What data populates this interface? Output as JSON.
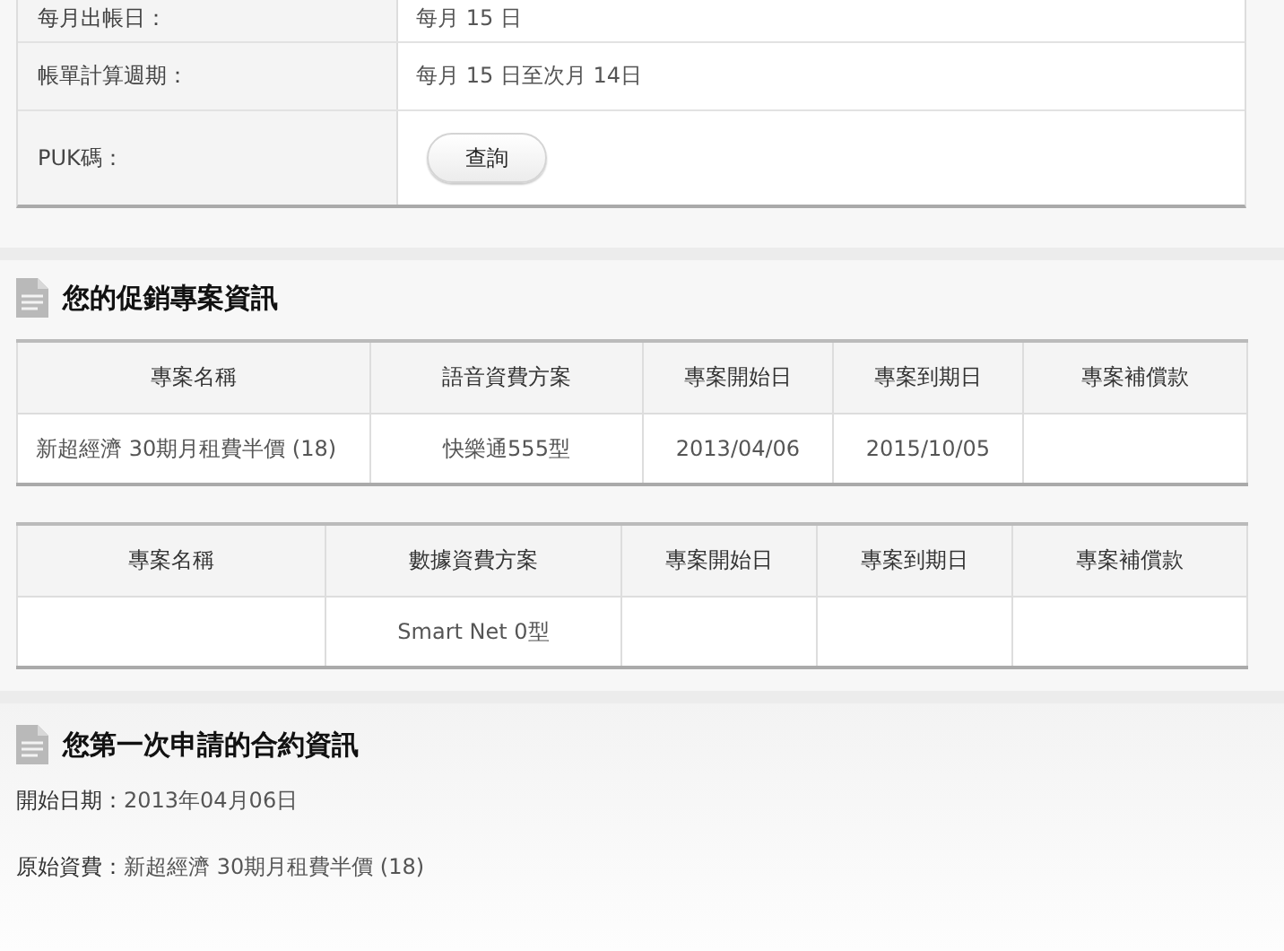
{
  "billing_info": {
    "rows": [
      {
        "label": "每月出帳日：",
        "value": "每月 15 日",
        "kind": "text"
      },
      {
        "label": "帳單計算週期：",
        "value": "每月 15 日至次月 14日",
        "kind": "text"
      },
      {
        "label": "PUK碼：",
        "value": "查詢",
        "kind": "button"
      }
    ]
  },
  "promotion_section": {
    "title": "您的促銷專案資訊",
    "tables": [
      {
        "columns": [
          "專案名稱",
          "語音資費方案",
          "專案開始日",
          "專案到期日",
          "專案補償款"
        ],
        "rows": [
          [
            "新超經濟 30期月租費半價 (18)",
            "快樂通555型",
            "2013/04/06",
            "2015/10/05",
            ""
          ]
        ]
      },
      {
        "columns": [
          "專案名稱",
          "數據資費方案",
          "專案開始日",
          "專案到期日",
          "專案補償款"
        ],
        "rows": [
          [
            "",
            "Smart Net 0型",
            "",
            "",
            ""
          ]
        ]
      }
    ]
  },
  "contract_section": {
    "title": "您第一次申請的合約資訊",
    "fields": [
      {
        "label": "開始日期：",
        "value": "2013年04月06日"
      },
      {
        "label": "原始資費：",
        "value": "新超經濟 30期月租費半價 (18)"
      }
    ]
  }
}
